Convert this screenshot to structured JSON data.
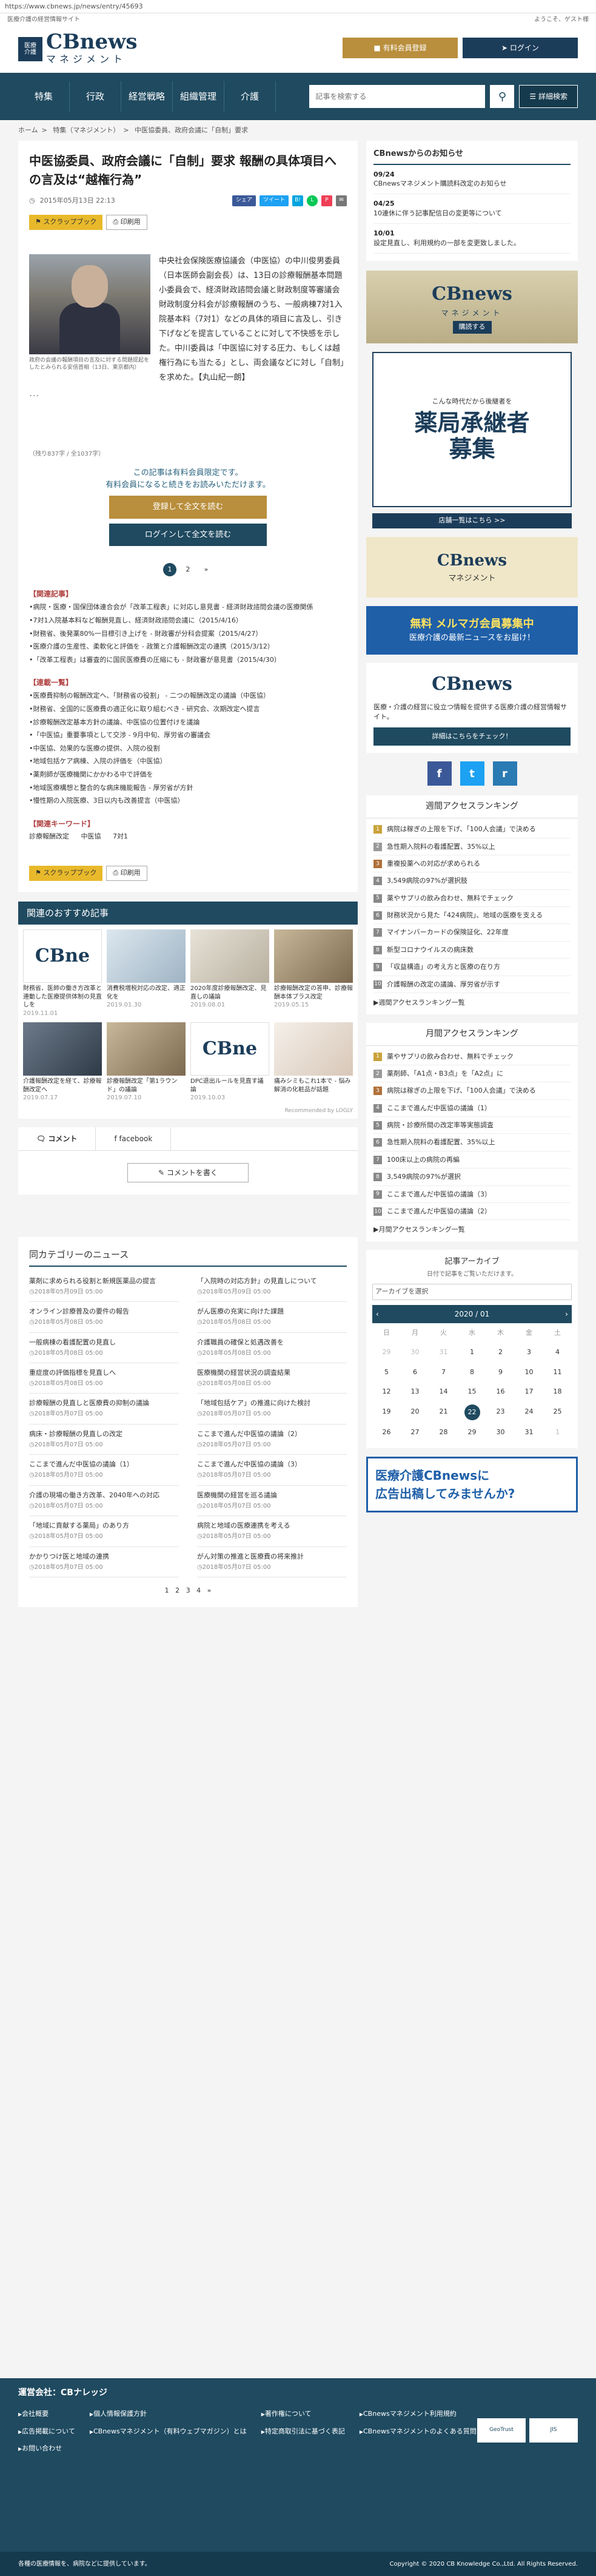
{
  "url": "https://www.cbnews.jp/news/entry/45693",
  "topstrip": {
    "tagline": "医療介護の経営情報サイト",
    "greeting": "ようこそ、ゲスト様"
  },
  "header": {
    "logo_badge_1": "医療",
    "logo_badge_2": "介護",
    "logo": "CBnews",
    "logo_sub": "マネジメント",
    "register": "有料会員登録",
    "login": "ログイン"
  },
  "nav": {
    "items": [
      "特集",
      "行政",
      "経営戦略",
      "組織管理",
      "介護"
    ],
    "search_placeholder": "記事を検索する",
    "detail_search": "詳細検索"
  },
  "breadcrumb": [
    "ホーム",
    "特集（マネジメント）",
    "中医協委員、政府会議に「自制」要求"
  ],
  "article": {
    "title": "中医協委員、政府会議に「自制」要求 報酬の具体項目への言及は“越権行為”",
    "date": "2015年05月13日 22:13",
    "share": {
      "fb": "シェア",
      "tw": "ツイート",
      "line": "L",
      "hb": "B!",
      "pocket": "P",
      "mail": "✉"
    },
    "scrap": "スクラップブック",
    "print": "印刷用",
    "caption": "政府の会議の報酬項目の言及に対する問題提起をしたとみられる安倍首相（13日、東京都内）",
    "lead": "中央社会保険医療協議会（中医協）の中川俊男委員（日本医師会副会長）は、13日の診療報酬基本問題小委員会で、経済財政諮問会議と財政制度等審議会財政制度分科会が診療報酬のうち、一般病棟7対1入院基本料（7対1）などの具体的項目に言及し、引き下げなどを提言していることに対して不快感を示した。中川委員は「中医協に対する圧力、もしくは越権行為にも当たる」とし、両会議などに対し「自制」を求めた。【丸山紀一朗】",
    "ellipsis": "･･･",
    "charcount": "（残り837字 / 全1037字）",
    "paywall_1": "この記事は有料会員限定です。",
    "paywall_2": "有料会員になると続きをお読みいただけます。",
    "register_btn": "登録して全文を読む",
    "login_btn": "ログインして全文を読む",
    "pages": [
      "1",
      "2",
      "»"
    ]
  },
  "related_h": "【関連記事】",
  "related": [
    "病院・医療・国保団体連合会が「改革工程表」に対応し意見書 - 経済財政諮問会議の医療関係",
    "7対1入院基本料など報酬見直し、経済財政諮問会議に（2015/4/16）",
    "財務省、後発薬80%一目標引き上げを - 財政審が分科会提案（2015/4/27）",
    "医療介護の生産性、柔軟化と評価を - 政策と介護報酬改定の連携（2015/3/12）",
    "「改革工程表」は審査的に国民医療費の圧縮にも - 財政審が意見書（2015/4/30）"
  ],
  "series_h": "【連載一覧】",
  "series": [
    "医療費抑制の報酬改定へ、「財務省の役割」 - 二つの報酬改定の議論（中医協）",
    "財務省、全国的に医療費の適正化に取り組むべき - 研究会、次期改定へ提言",
    "診療報酬改定基本方針の議論、中医協の位置付けを議論",
    "「中医協」重要事項として交渉 - 9月中旬、厚労省の審議会",
    "中医協、効果的な医療の提供、入院の役割",
    "地域包括ケア病棟、入院の評価を（中医協）",
    "薬剤師が医療機関にかかわる中で評価を",
    "地域医療構想と整合的な病床機能報告 - 厚労省が方針",
    "慢性期の入院医療、3日以内も改善提言（中医協）"
  ],
  "keyword_h": "【関連キーワード】",
  "keywords": [
    "診療報酬改定",
    "中医協",
    "7対1"
  ],
  "recommend": {
    "title": "関連のおすすめ記事",
    "items": [
      {
        "logo": "CBne",
        "text": "財務省、医師の働き方改革と連動した医療提供体制の見直しを",
        "date": "2019.11.01"
      },
      {
        "logo": "",
        "text": "消費税増税対応の改定、適正化を",
        "date": "2019.01.30"
      },
      {
        "logo": "",
        "text": "2020年度診療報酬改定、見直しの議論",
        "date": "2019.08.01"
      },
      {
        "logo": "",
        "text": "診療報酬改定の答申、診療報酬本体プラス改定",
        "date": "2019.05.15"
      },
      {
        "logo": "",
        "text": "介護報酬改定を経て、診療報酬改定へ",
        "date": "2019.07.17"
      },
      {
        "logo": "",
        "text": "診療報酬改定「第1ラウンド」の議論",
        "date": "2019.07.10"
      },
      {
        "logo": "CBne",
        "text": "DPC退出ルールを見直す議論",
        "date": "2019.10.03"
      },
      {
        "logo": "",
        "text": "痛みシミもこれ1本で - 悩み解消の化粧品が話題",
        "date": ""
      }
    ],
    "by": "Recommended by LOGLY"
  },
  "comment_tabs": [
    "コメント",
    "facebook"
  ],
  "write_comment": "コメントを書く",
  "news": {
    "title": "同カテゴリーのニュース",
    "items": [
      {
        "text": "薬剤に求められる役割と新規医薬品の提言",
        "date": "2018年05月09日 05:00"
      },
      {
        "text": "「入院時の対応方針」の見直しについて",
        "date": "2018年05月09日 05:00"
      },
      {
        "text": "オンライン診療普及の要件の報告",
        "date": "2018年05月08日 05:00"
      },
      {
        "text": "がん医療の充実に向けた課題",
        "date": "2018年05月08日 05:00"
      },
      {
        "text": "一般病棟の看護配置の見直し",
        "date": "2018年05月08日 05:00"
      },
      {
        "text": "介護職員の確保と処遇改善を",
        "date": "2018年05月08日 05:00"
      },
      {
        "text": "重症度の評価指標を見直しへ",
        "date": "2018年05月08日 05:00"
      },
      {
        "text": "医療機関の経営状況の調査結果",
        "date": "2018年05月08日 05:00"
      },
      {
        "text": "診療報酬の見直しと医療費の抑制の議論",
        "date": "2018年05月07日 05:00"
      },
      {
        "text": "「地域包括ケア」の推進に向けた検討",
        "date": "2018年05月07日 05:00"
      },
      {
        "text": "病床・診療報酬の見直しの改定",
        "date": "2018年05月07日 05:00"
      },
      {
        "text": "ここまで進んだ中医協の議論（2）",
        "date": "2018年05月07日 05:00"
      },
      {
        "text": "ここまで進んだ中医協の議論（1）",
        "date": "2018年05月07日 05:00"
      },
      {
        "text": "ここまで進んだ中医協の議論（3）",
        "date": "2018年05月07日 05:00"
      },
      {
        "text": "介護の現場の働き方改革、2040年への対応",
        "date": "2018年05月07日 05:00"
      },
      {
        "text": "医療機関の経営を巡る議論",
        "date": "2018年05月07日 05:00"
      },
      {
        "text": "「地域に貢献する薬局」のあり方",
        "date": "2018年05月07日 05:00"
      },
      {
        "text": "病院と地域の医療連携を考える",
        "date": "2018年05月07日 05:00"
      },
      {
        "text": "かかりつけ医と地域の連携",
        "date": "2018年05月07日 05:00"
      },
      {
        "text": "がん対策の推進と医療費の将来推計",
        "date": "2018年05月07日 05:00"
      }
    ],
    "pages": [
      "1",
      "2",
      "3",
      "4",
      "»"
    ]
  },
  "side": {
    "notice_h": "CBnewsからのお知らせ",
    "notices": [
      {
        "date": "09/24",
        "text": "CBnewsマネジメント購読料改定のお知らせ"
      },
      {
        "date": "04/25",
        "text": "10連休に伴う記事配信日の変更等について"
      },
      {
        "date": "10/01",
        "text": "設定見直し、利用規約の一部を変更致しました。"
      }
    ],
    "ad1": {
      "title": "CBnews",
      "sub": "マネジメント",
      "buy": "購読する"
    },
    "ad2": {
      "small": "こんな時代だから後継者を",
      "big1": "薬局承継者",
      "big2": "募集",
      "link": "店舗一覧はこちら >>"
    },
    "ad3": {
      "title": "CBnews",
      "sub": "マネジメント"
    },
    "ad4": {
      "title": "無料 メルマガ会員募集中",
      "sub": "医療介護の最新ニュースをお届け！"
    },
    "about": {
      "title": "CBnews",
      "text": "医療・介護の経営に役立つ情報を提供する医療介護の経営情報サイト。",
      "btn": "詳細はこちらをチェック！"
    },
    "social": [
      "f",
      "t",
      "r"
    ],
    "weekly_h": "週間アクセスランキング",
    "weekly": [
      "病院は稼ぎの上限を下げ、「100人会議」で決める",
      "急性期入院料の看護配置、35%以上",
      "重複投薬への対応が求められる",
      "3,549病院の97%が選択肢",
      "薬やサプリの飲み合わせ、無料でチェック",
      "財務状況から見た「424病院」、地域の医療を支える",
      "マイナンバーカードの保険証化、22年度",
      "新型コロナウイルスの病床数",
      "「収益構造」の考え方と医療の在り方",
      "介護報酬の改定の議論、厚労省が示す"
    ],
    "weekly_more": "週間アクセスランキング一覧",
    "monthly_h": "月間アクセスランキング",
    "monthly": [
      "薬やサプリの飲み合わせ、無料でチェック",
      "薬剤師、「A1点・B3点」を「A2点」に",
      "病院は稼ぎの上限を下げ、「100人会議」で決める",
      "ここまで進んだ中医協の議論（1）",
      "病院・診療所間の改定率等実態調査",
      "急性期入院料の看護配置、35%以上",
      "100床以上の病院の再編",
      "3,549病院の97%が選択",
      "ここまで進んだ中医協の議論（3）",
      "ここまで進んだ中医協の議論（2）"
    ],
    "monthly_more": "月間アクセスランキング一覧",
    "calendar": {
      "title": "記事アーカイブ",
      "sub": "日付で記事をご覧いただけます。",
      "select": "アーカイブを選択",
      "month": "2020 / 01",
      "weekdays": [
        "日",
        "月",
        "火",
        "水",
        "木",
        "金",
        "土"
      ],
      "days": [
        "29",
        "30",
        "31",
        "1",
        "2",
        "3",
        "4",
        "5",
        "6",
        "7",
        "8",
        "9",
        "10",
        "11",
        "12",
        "13",
        "14",
        "15",
        "16",
        "17",
        "18",
        "19",
        "20",
        "21",
        "22",
        "23",
        "24",
        "25",
        "26",
        "27",
        "28",
        "29",
        "30",
        "31",
        "1"
      ],
      "selected": "22"
    },
    "ad5": {
      "t1": "医療介護CBnewsに",
      "t2": "広告出稿してみませんか?"
    }
  },
  "footer": {
    "company": "運営会社：CBナレッジ",
    "links": [
      "会社概要",
      "個人情報保護方針",
      "著作権について",
      "CBnewsマネジメント利用規約",
      "広告掲載について",
      "CBnewsマネジメント（有料ウェブマガジン）とは",
      "特定商取引法に基づく表記",
      "CBnewsマネジメントのよくある質問",
      "お問い合わせ"
    ],
    "note": "各種の医療情報を、病院などに提供しています。",
    "copyright": "Copyright © 2020 CB Knowledge Co.,Ltd. All Rights Reserved."
  }
}
